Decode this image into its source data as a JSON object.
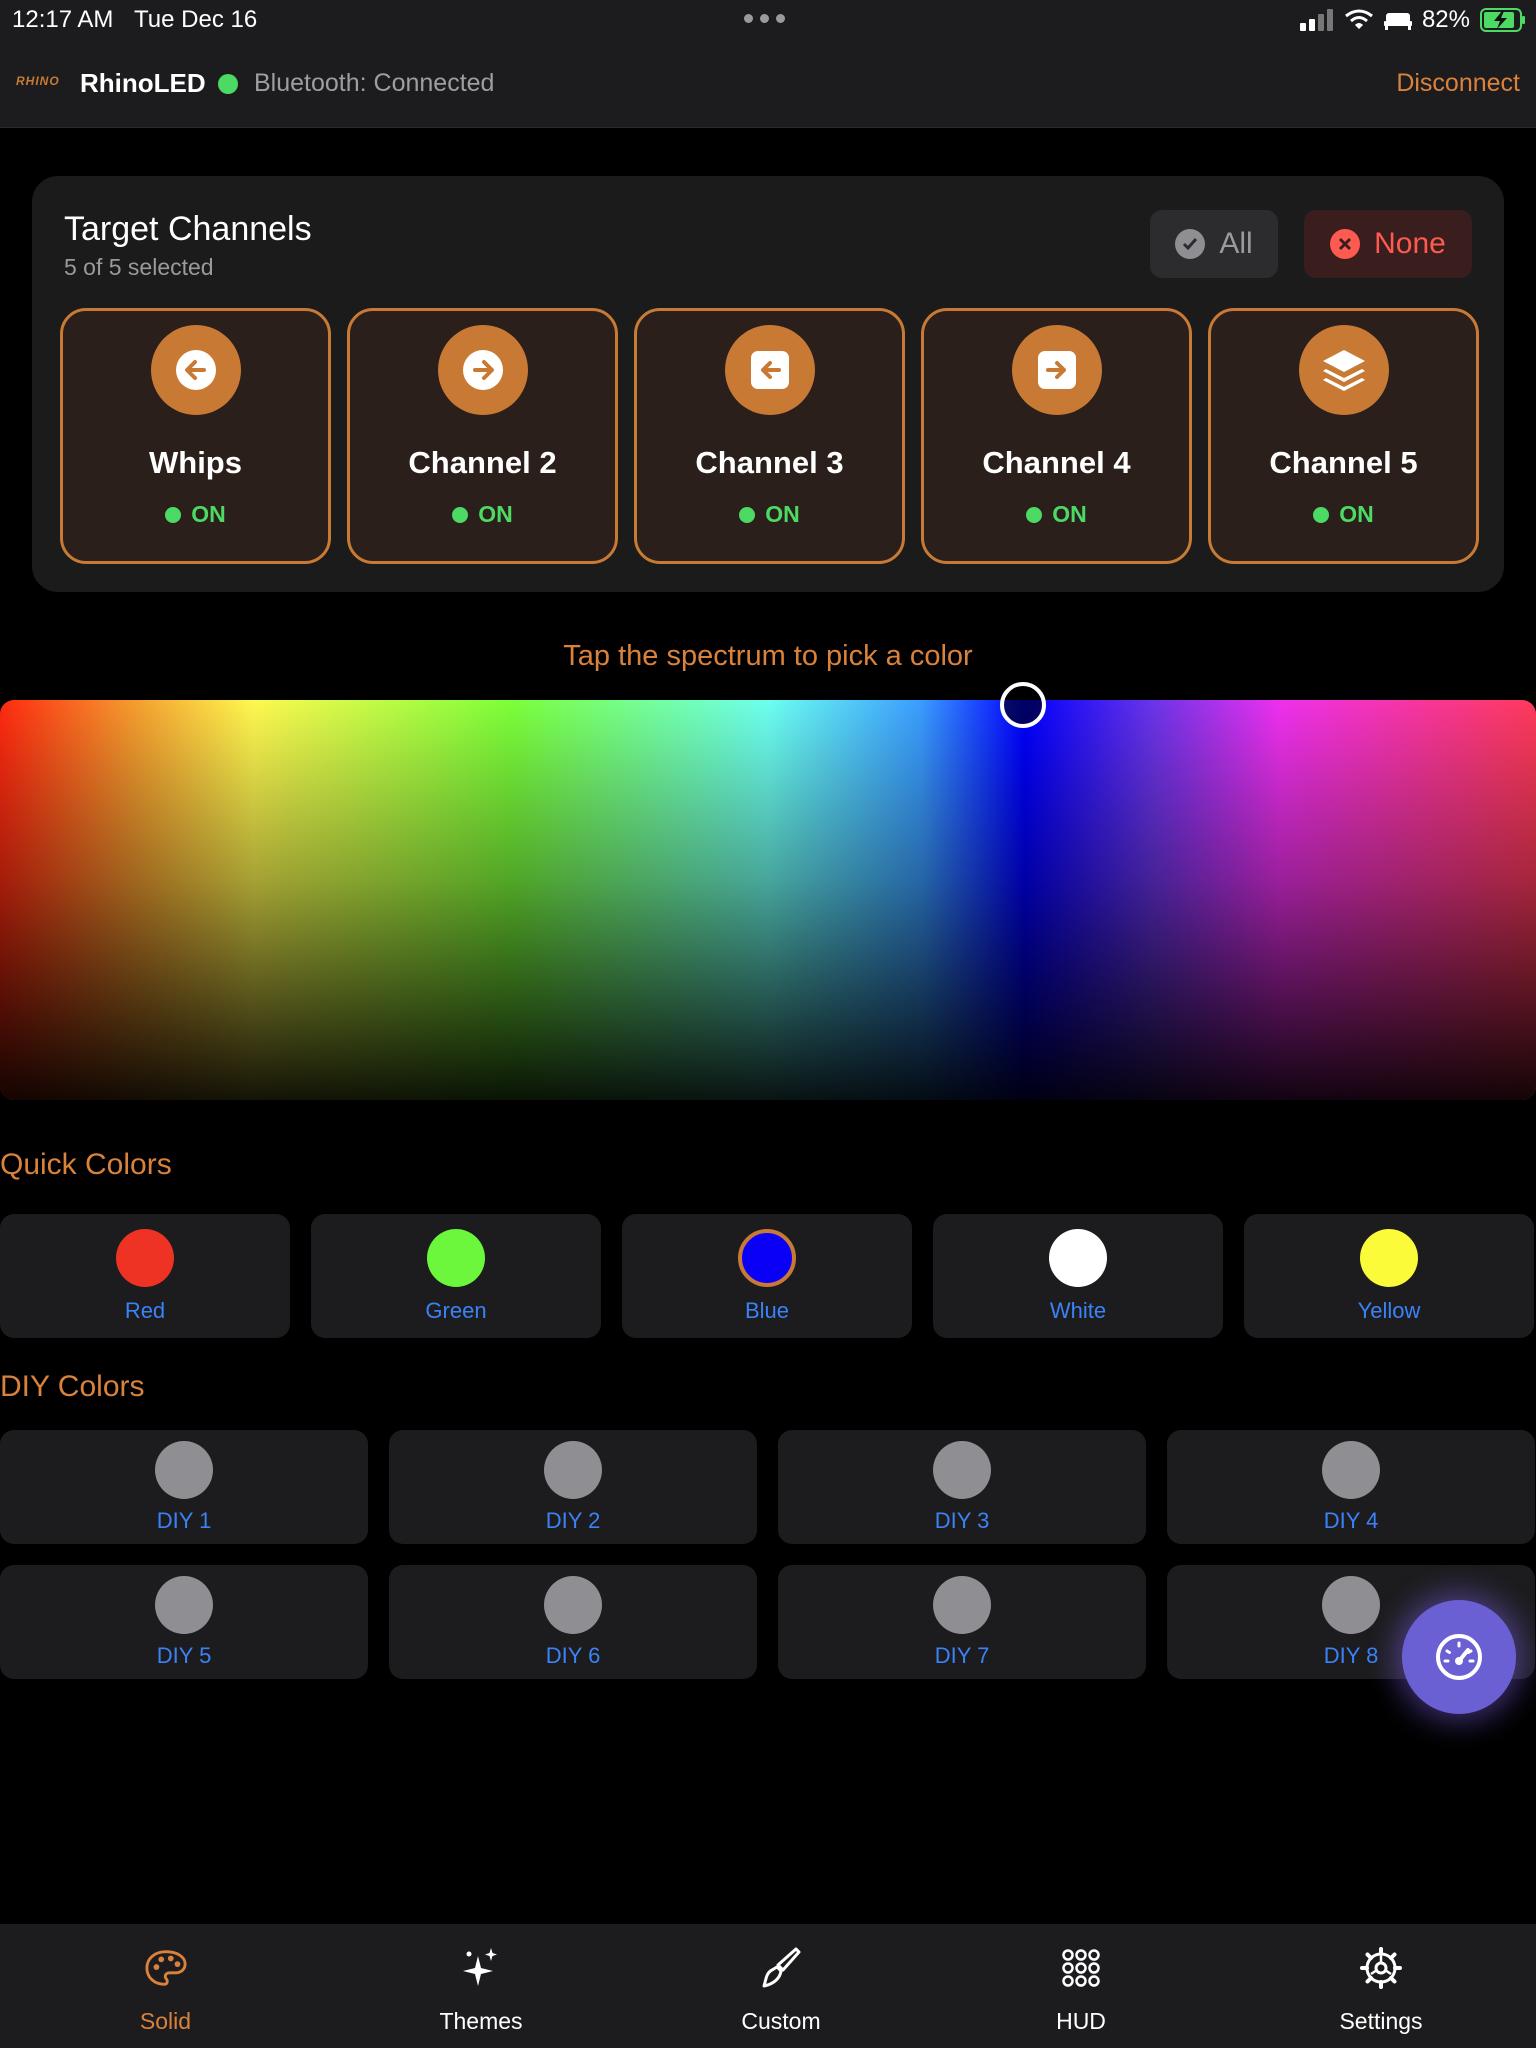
{
  "status_bar": {
    "time": "12:17 AM",
    "date": "Tue Dec 16",
    "battery": "82%"
  },
  "header": {
    "logo": "RHINO",
    "app_name": "RhinoLED",
    "bluetooth_status": "Bluetooth: Connected",
    "disconnect_label": "Disconnect"
  },
  "target_channels": {
    "title": "Target Channels",
    "subtitle": "5 of 5 selected",
    "all_label": "All",
    "none_label": "None",
    "channels": [
      {
        "name": "Whips",
        "status": "ON",
        "icon": "arrow-left-circle-icon"
      },
      {
        "name": "Channel 2",
        "status": "ON",
        "icon": "arrow-right-circle-icon"
      },
      {
        "name": "Channel 3",
        "status": "ON",
        "icon": "arrow-left-square-icon"
      },
      {
        "name": "Channel 4",
        "status": "ON",
        "icon": "arrow-right-square-icon"
      },
      {
        "name": "Channel 5",
        "status": "ON",
        "icon": "layers-icon"
      }
    ]
  },
  "spectrum": {
    "hint": "Tap the spectrum to pick a color"
  },
  "quick_colors": {
    "title": "Quick Colors",
    "items": [
      {
        "label": "Red",
        "color": "#ee3324"
      },
      {
        "label": "Green",
        "color": "#6cf63c"
      },
      {
        "label": "Blue",
        "color": "#0a00f5"
      },
      {
        "label": "White",
        "color": "#ffffff"
      },
      {
        "label": "Yellow",
        "color": "#fbfb3a"
      }
    ]
  },
  "diy_colors": {
    "title": "DIY Colors",
    "items": [
      "DIY 1",
      "DIY 2",
      "DIY 3",
      "DIY 4",
      "DIY 5",
      "DIY 6",
      "DIY 7",
      "DIY 8"
    ]
  },
  "tabs": [
    {
      "label": "Solid",
      "icon": "palette-icon"
    },
    {
      "label": "Themes",
      "icon": "sparkles-icon"
    },
    {
      "label": "Custom",
      "icon": "paintbrush-icon"
    },
    {
      "label": "HUD",
      "icon": "grid-dots-icon"
    },
    {
      "label": "Settings",
      "icon": "gear-icon"
    }
  ],
  "colors": {
    "accent": "#c87a35",
    "accent_text": "#d9823b",
    "on_green": "#4cd964",
    "link_blue": "#3a82f6",
    "danger": "#ff5a4f"
  }
}
